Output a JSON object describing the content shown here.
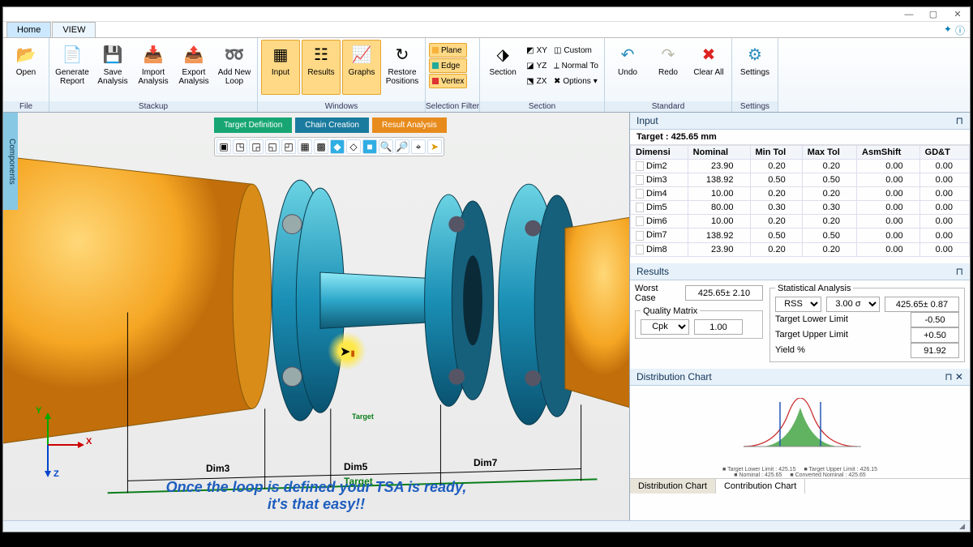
{
  "tabs": {
    "home": "Home",
    "view": "VIEW"
  },
  "ribbon": {
    "file": {
      "label": "File",
      "open": "Open"
    },
    "stackup": {
      "label": "Stackup",
      "generate": "Generate Report",
      "save": "Save Analysis",
      "import": "Import Analysis",
      "export": "Export Analysis",
      "addNew": "Add New Loop"
    },
    "windows": {
      "label": "Windows",
      "input": "Input",
      "results": "Results",
      "graphs": "Graphs",
      "restore": "Restore Positions"
    },
    "selFilter": {
      "label": "Selection Filter",
      "plane": "Plane",
      "edge": "Edge",
      "vertex": "Vertex"
    },
    "section": {
      "label": "Section",
      "section": "Section",
      "xy": "XY",
      "yz": "YZ",
      "zx": "ZX",
      "custom": "Custom",
      "normal": "Normal To",
      "options": "Options"
    },
    "standard": {
      "label": "Standard",
      "undo": "Undo",
      "redo": "Redo",
      "clear": "Clear All"
    },
    "settings": {
      "label": "Settings",
      "settings": "Settings"
    }
  },
  "sidebarTab": "Components",
  "steps": {
    "a": "Target Definition",
    "b": "Chain Creation",
    "c": "Result Analysis"
  },
  "viewport": {
    "dim3": "Dim3",
    "dim5": "Dim5",
    "dim7": "Dim7",
    "target": "Target",
    "short_target": "Target",
    "subtitle_l1": "Once the loop is defined your TSA is ready,",
    "subtitle_l2": "it's that easy!!",
    "axes": {
      "x": "X",
      "y": "Y",
      "z": "Z"
    }
  },
  "input": {
    "title": "Input",
    "target": "Target : 425.65 mm",
    "headers": {
      "dim": "Dimensi",
      "nom": "Nominal",
      "min": "Min Tol",
      "max": "Max Tol",
      "shift": "AsmShift",
      "gdt": "GD&T"
    },
    "rows": [
      {
        "d": "Dim2",
        "n": "23.90",
        "min": "0.20",
        "max": "0.20",
        "s": "0.00",
        "g": "0.00"
      },
      {
        "d": "Dim3",
        "n": "138.92",
        "min": "0.50",
        "max": "0.50",
        "s": "0.00",
        "g": "0.00"
      },
      {
        "d": "Dim4",
        "n": "10.00",
        "min": "0.20",
        "max": "0.20",
        "s": "0.00",
        "g": "0.00"
      },
      {
        "d": "Dim5",
        "n": "80.00",
        "min": "0.30",
        "max": "0.30",
        "s": "0.00",
        "g": "0.00"
      },
      {
        "d": "Dim6",
        "n": "10.00",
        "min": "0.20",
        "max": "0.20",
        "s": "0.00",
        "g": "0.00"
      },
      {
        "d": "Dim7",
        "n": "138.92",
        "min": "0.50",
        "max": "0.50",
        "s": "0.00",
        "g": "0.00"
      },
      {
        "d": "Dim8",
        "n": "23.90",
        "min": "0.20",
        "max": "0.20",
        "s": "0.00",
        "g": "0.00"
      }
    ]
  },
  "results": {
    "title": "Results",
    "worstCase": "Worst Case",
    "worstVal": "425.65± 2.10",
    "quality": "Quality Matrix",
    "cpk": "Cpk",
    "cpkVal": "1.00",
    "stat": "Statistical Analysis",
    "rss": "RSS",
    "sigma": "3.00 σ",
    "statVal": "425.65± 0.87",
    "lower": "Target Lower Limit",
    "lowerVal": "-0.50",
    "upper": "Target Upper Limit",
    "upperVal": "+0.50",
    "yield": "Yield %",
    "yieldVal": "91.92"
  },
  "distChart": {
    "title": "Distribution Chart",
    "tab1": "Distribution Chart",
    "tab2": "Contribution Chart",
    "legend": {
      "l1": "Target Lower Limit : 425.15",
      "l2": "Nominal : 425.65",
      "l3": "Target Upper Limit : 426.15",
      "l4": "Converted Nominal : 425.65"
    }
  }
}
